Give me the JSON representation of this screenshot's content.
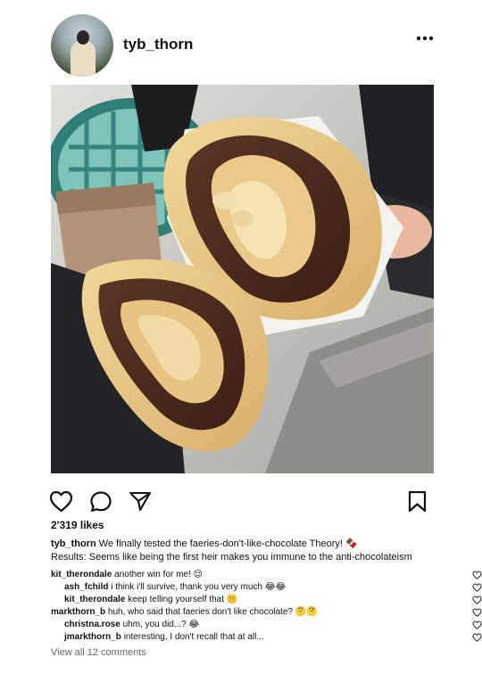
{
  "post": {
    "username": "tyb_thorn",
    "likes_text": "2'319 likes",
    "caption": {
      "user": "tyb_thorn",
      "line1": "We finally tested the faeries-don't-like-chocolate Theory! 🍫",
      "line2": "Results: Seems like being the first heir makes you immune to the anti-chocolateism"
    },
    "comments": [
      {
        "user": "kit_therondale",
        "text": "another win for me! 😌",
        "reply": false
      },
      {
        "user": "ash_fchild",
        "text": "i think i'll survive, thank you very much 😂😂",
        "reply": true
      },
      {
        "user": "kit_therondale",
        "text": "keep telling yourself that 🤫",
        "reply": true
      },
      {
        "user": "markthorn_b",
        "text": "huh, who said that faeries don't like chocolate? 🤔🤔",
        "reply": false
      },
      {
        "user": "christna.rose",
        "text": "uhm, you did...? 😂",
        "reply": true
      },
      {
        "user": "jmarkthorn_b",
        "text": "interesting, I don't recall that at all...",
        "reply": true
      }
    ],
    "view_all_text": "View all 12 comments"
  },
  "icons": {
    "more": "more-options-icon",
    "like": "heart-icon",
    "comment": "comment-bubble-icon",
    "share": "paper-plane-icon",
    "save": "bookmark-icon"
  },
  "colors": {
    "text": "#111111",
    "muted": "#666666",
    "background": "#ffffff"
  }
}
